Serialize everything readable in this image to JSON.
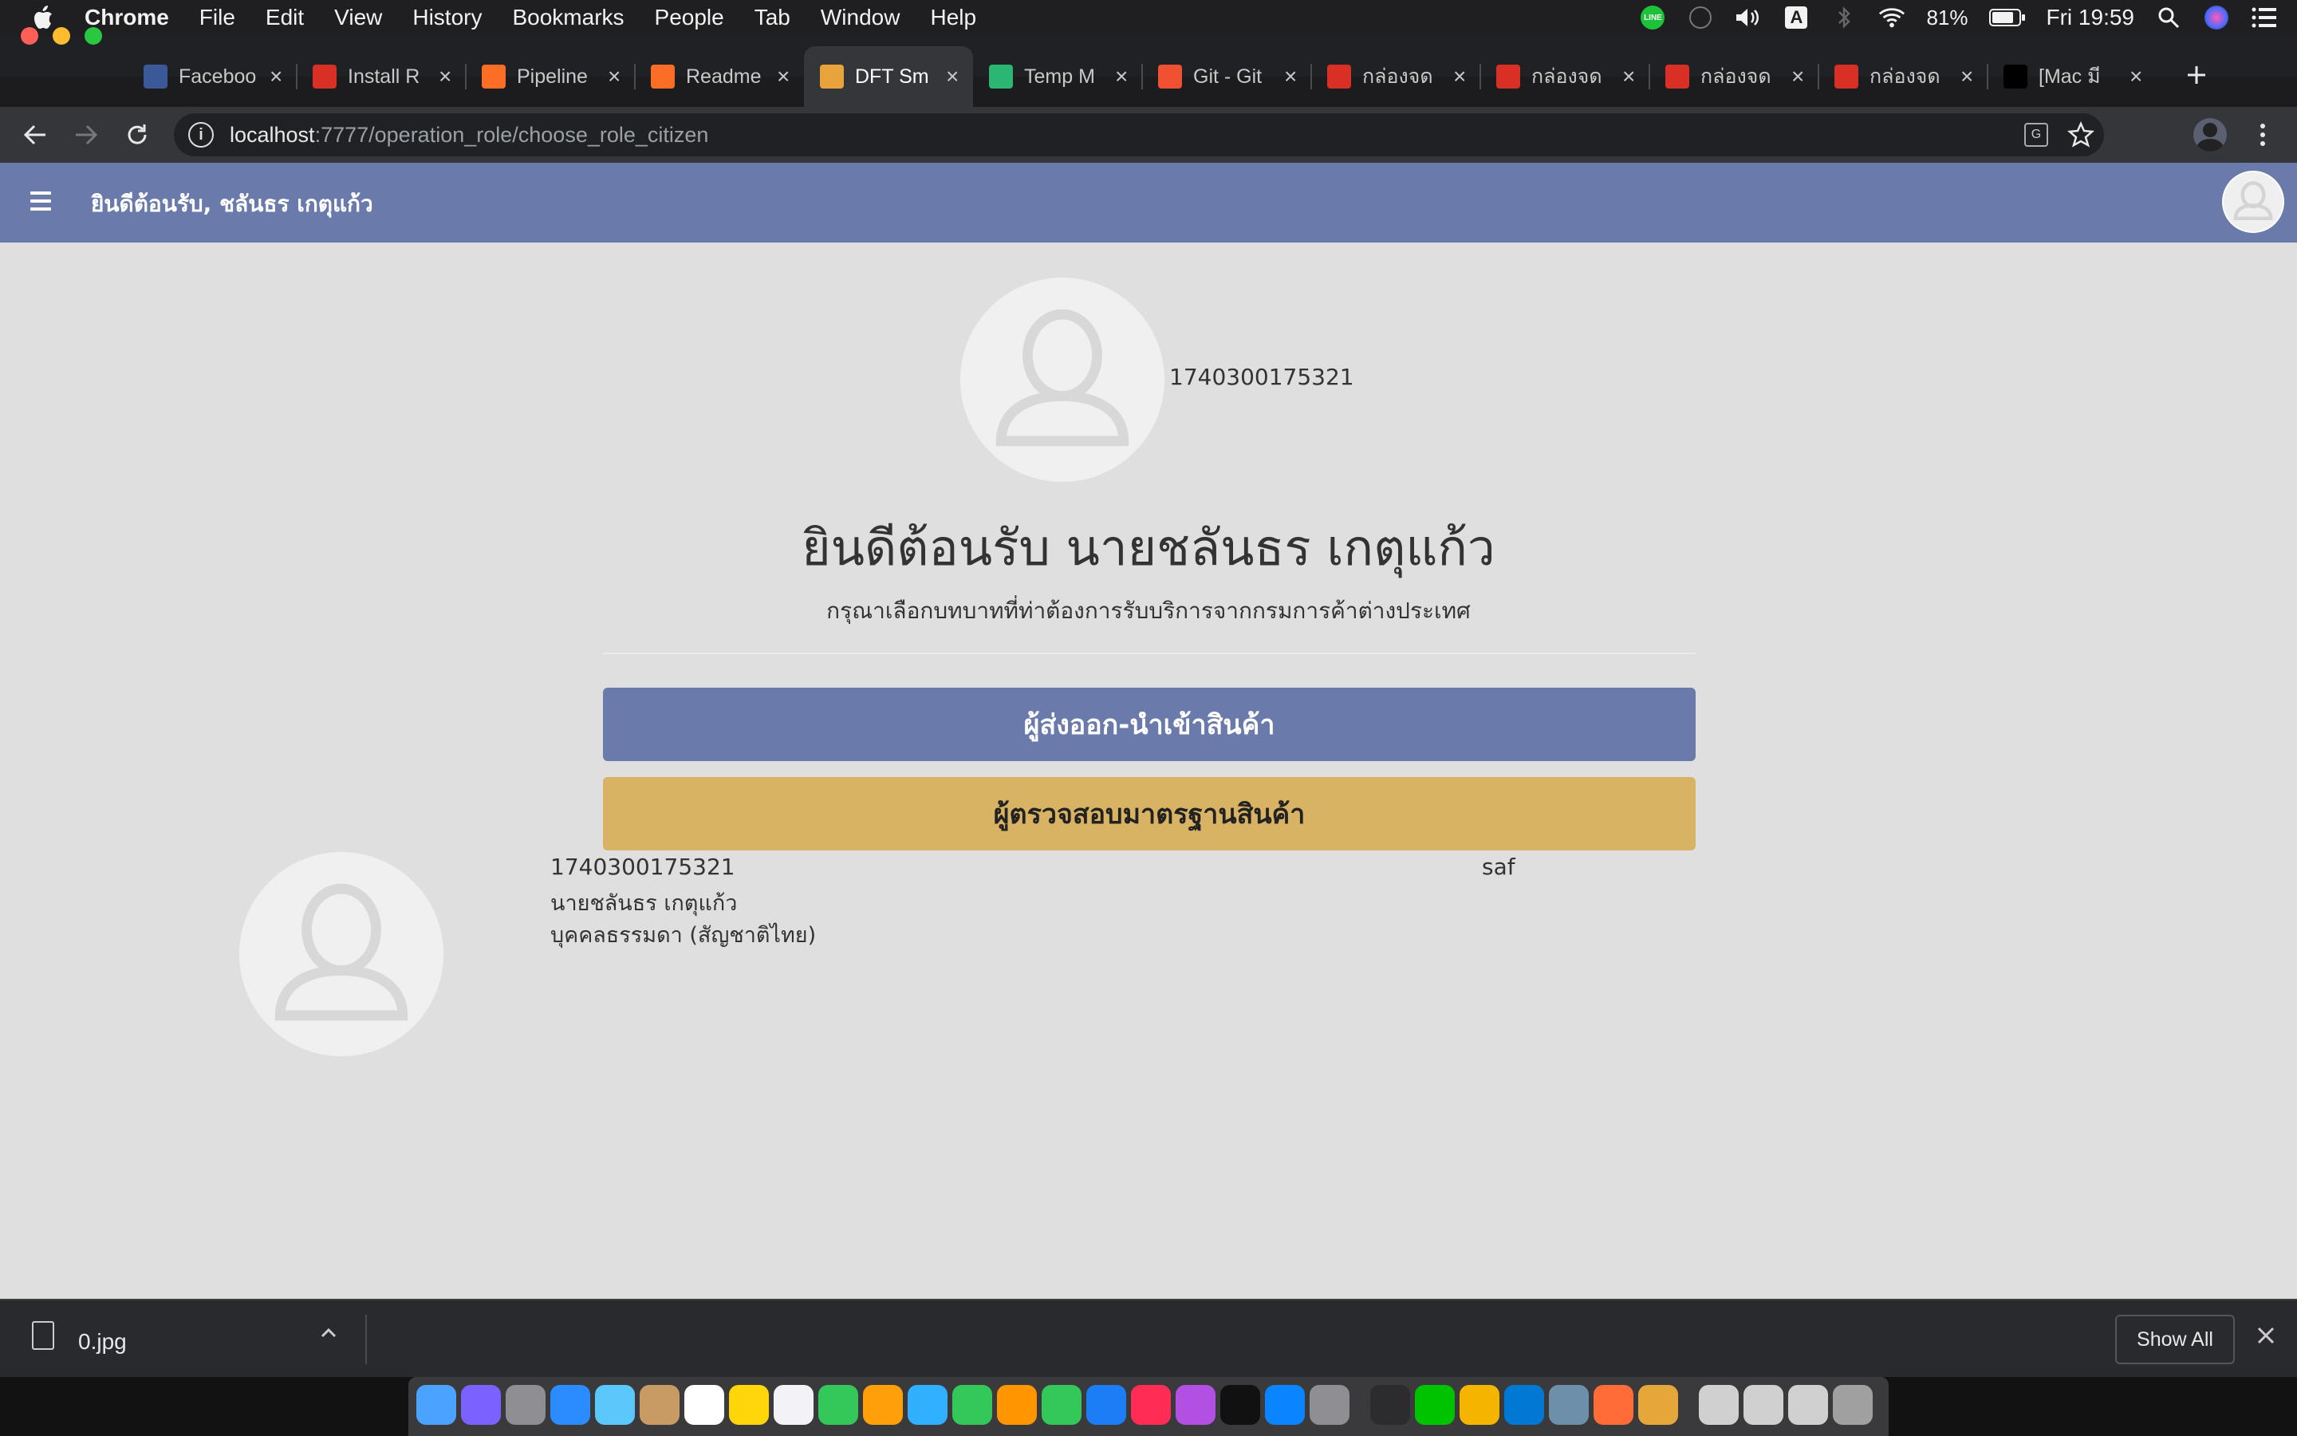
{
  "menubar": {
    "app_name": "Chrome",
    "menus": [
      "File",
      "Edit",
      "View",
      "History",
      "Bookmarks",
      "People",
      "Tab",
      "Window",
      "Help"
    ],
    "battery": "81%",
    "clock": "Fri 19:59",
    "input_source": "A"
  },
  "tabs": [
    {
      "title": "Faceboo",
      "icon": "facebook-icon",
      "color": "#3b5998"
    },
    {
      "title": "Install R",
      "icon": "react-native-icon",
      "color": "#d93025"
    },
    {
      "title": "Pipeline",
      "icon": "gitlab-icon",
      "color": "#fc6d26"
    },
    {
      "title": "Readme",
      "icon": "gitlab-icon",
      "color": "#fc6d26"
    },
    {
      "title": "DFT Sm",
      "icon": "dft-icon",
      "color": "#e8a33d"
    },
    {
      "title": "Temp M",
      "icon": "temp-mail-icon",
      "color": "#2bb673"
    },
    {
      "title": "Git - Git",
      "icon": "git-icon",
      "color": "#f05133"
    },
    {
      "title": "กล่องจด",
      "icon": "gmail-icon",
      "color": "#d93025"
    },
    {
      "title": "กล่องจด",
      "icon": "gmail-icon",
      "color": "#d93025"
    },
    {
      "title": "กล่องจด",
      "icon": "gmail-icon",
      "color": "#d93025"
    },
    {
      "title": "กล่องจด",
      "icon": "gmail-icon",
      "color": "#d93025"
    },
    {
      "title": "[Mac มี",
      "icon": "medium-icon",
      "color": "#000000"
    }
  ],
  "active_tab_index": 4,
  "address": {
    "host": "localhost",
    "path": ":7777/operation_role/choose_role_citizen"
  },
  "appbar": {
    "welcome": "ยินดีต้อนรับ, ชลันธร เกตุแก้ว"
  },
  "profile": {
    "id": "1740300175321",
    "heading": "ยินดีต้อนรับ นายชลันธร เกตุแก้ว",
    "subtitle": "กรุณาเลือกบทบาทที่ท่าต้องการรับบริการจากกรมการค้าต่างประเทศ"
  },
  "roles": {
    "exporter": "ผู้ส่งออก-นำเข้าสินค้า",
    "inspector": "ผู้ตรวจสอบมาตรฐานสินค้า"
  },
  "user_card": {
    "id": "1740300175321",
    "name": "นายชลันธร เกตุแก้ว",
    "type": "บุคคลธรรมดา (สัญชาติไทย)",
    "extra": "saf"
  },
  "download": {
    "filename": "0.jpg",
    "show_all": "Show All"
  },
  "colors": {
    "primary": "#6a7aab",
    "secondary": "#d8b363",
    "page_bg": "#dfdfdf"
  },
  "dock_icons": [
    "finder-icon",
    "siri-icon",
    "launchpad-icon",
    "safari-icon",
    "preview-icon",
    "contacts-icon",
    "calendar-icon",
    "notes-icon",
    "reminders-icon",
    "maps-icon",
    "photos-icon",
    "messages-icon",
    "facetime-icon",
    "pages-icon",
    "numbers-icon",
    "keynote-icon",
    "music-icon",
    "podcasts-icon",
    "tv-icon",
    "app-store-icon",
    "system-preferences-icon",
    "terminal-icon",
    "line-icon",
    "chrome-icon",
    "vscode-icon",
    "image-capture-icon",
    "postman-icon",
    "sequel-icon",
    "downloads-stack-icon",
    "documents-stack-icon",
    "screenshots-stack-icon",
    "trash-icon"
  ]
}
